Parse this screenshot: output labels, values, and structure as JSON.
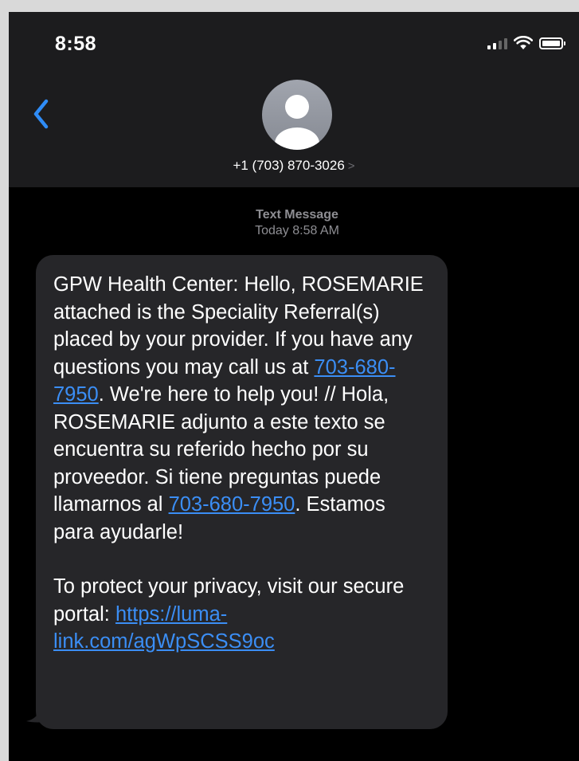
{
  "status_bar": {
    "time": "8:58",
    "signal_icon": "cellular-signal-icon",
    "wifi_icon": "wifi-icon",
    "battery_icon": "battery-icon"
  },
  "header": {
    "back_icon": "chevron-left-icon",
    "avatar_icon": "person-silhouette-icon",
    "contact": "+1 (703) 870-3026",
    "contact_chevron": ">"
  },
  "thread": {
    "kind": "Text Message",
    "timestamp": "Today 8:58 AM"
  },
  "message": {
    "part1": "GPW Health Center: Hello, ROSEMARIE  attached is the Speciality Referral(s) placed by your provider. If you have any questions you may call us at ",
    "phone1": "703-680-7950",
    "part2": ". We're here to help you! // Hola,  ROSEMARIE adjunto a este texto se encuentra su referido hecho por su proveedor. Si tiene preguntas puede llamarnos al ",
    "phone2": "703-680-7950",
    "part3": ". Estamos para ayudarle!",
    "part4": "To protect your privacy, visit our secure portal: ",
    "portal_link": "https://luma-link.com/agWpSCSS9oc"
  },
  "colors": {
    "link": "#3b8ef5",
    "bubble": "#262629",
    "header_bg": "#1c1c1e",
    "background": "#000000"
  }
}
